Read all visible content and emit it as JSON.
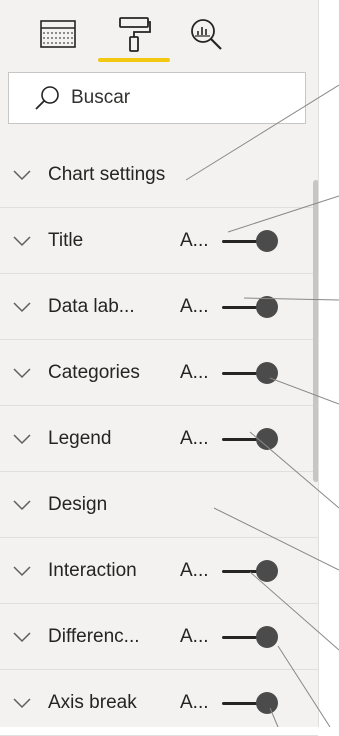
{
  "tabs": [
    {
      "name": "fields",
      "icon": "table-icon"
    },
    {
      "name": "format",
      "icon": "paint-roller-icon"
    },
    {
      "name": "analytics",
      "icon": "magnifier-chart-icon"
    }
  ],
  "search": {
    "placeholder": "Buscar"
  },
  "sections": [
    {
      "label": "Chart settings",
      "value": "",
      "toggle": false
    },
    {
      "label": "Title",
      "value": "A...",
      "toggle": true
    },
    {
      "label": "Data lab...",
      "value": "A...",
      "toggle": true
    },
    {
      "label": "Categories",
      "value": "A...",
      "toggle": true
    },
    {
      "label": "Legend",
      "value": "A...",
      "toggle": true
    },
    {
      "label": "Design",
      "value": "",
      "toggle": false
    },
    {
      "label": "Interaction",
      "value": "A...",
      "toggle": true
    },
    {
      "label": "Differenc...",
      "value": "A...",
      "toggle": true
    },
    {
      "label": "Axis break",
      "value": "A...",
      "toggle": true
    }
  ],
  "colors": {
    "accent": "#f2c811",
    "panel": "#f3f2f1",
    "knob": "#4b4b4b"
  }
}
